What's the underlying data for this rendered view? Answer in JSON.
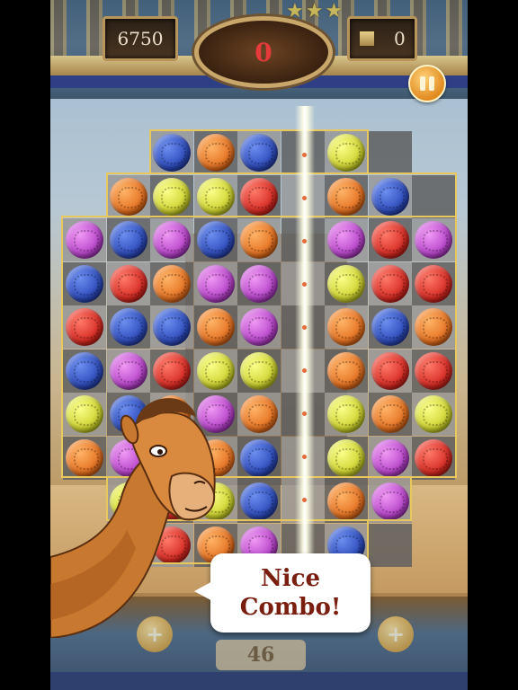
{
  "hud": {
    "score": "6750",
    "moves": "0",
    "blocks_count": "0",
    "stars": [
      "★",
      "★",
      "★"
    ],
    "pause_icon": "pause-icon"
  },
  "speech_bubble": {
    "line1": "Nice",
    "line2": "Combo!"
  },
  "bottom": {
    "number": "46",
    "boost_symbol": "+"
  },
  "board": {
    "rows": [
      [
        null,
        null,
        "light",
        "dark",
        "light",
        "dark",
        "light",
        "dark",
        null
      ],
      [
        null,
        "light",
        "dark",
        "light",
        "dark",
        "light",
        "dark",
        "light",
        "dark"
      ],
      [
        "light",
        "dark",
        "light",
        "dark",
        "light",
        "dark",
        "light",
        "dark",
        "light"
      ],
      [
        "dark",
        "light",
        "dark",
        "light",
        "dark",
        "light",
        "dark",
        "light",
        "dark"
      ],
      [
        "light",
        "dark",
        "light",
        "dark",
        "light",
        "dark",
        "light",
        "dark",
        "light"
      ],
      [
        "dark",
        "light",
        "dark",
        "light",
        "dark",
        "light",
        "dark",
        "light",
        "dark"
      ],
      [
        "light",
        "dark",
        "light",
        "dark",
        "light",
        "dark",
        "light",
        "dark",
        "light"
      ],
      [
        "dark",
        "light",
        "dark",
        "light",
        "dark",
        "light",
        "dark",
        "light",
        "dark"
      ],
      [
        null,
        "light",
        "dark",
        "light",
        "dark",
        "light",
        "dark",
        "light",
        null
      ],
      [
        null,
        null,
        "light",
        "dark",
        "light",
        "dark",
        "light",
        "dark",
        null
      ]
    ],
    "gems": [
      [
        null,
        null,
        "blue",
        "orange",
        "blue",
        null,
        "yellow",
        null,
        null
      ],
      [
        null,
        "orange",
        "yellow",
        "yellow",
        "red",
        null,
        "orange",
        "blue",
        null
      ],
      [
        "purple",
        "blue",
        "purple",
        "blue",
        "orange",
        null,
        "purple",
        "red",
        "purple"
      ],
      [
        "blue",
        "red",
        "orange",
        "purple",
        "purple",
        null,
        "yellow",
        "red",
        "red"
      ],
      [
        "red",
        "blue",
        "blue",
        "orange",
        "purple",
        null,
        "orange",
        "blue",
        "orange"
      ],
      [
        "blue",
        "purple",
        "red",
        "yellow",
        "yellow",
        null,
        "orange",
        "red",
        "red"
      ],
      [
        "yellow",
        "blue",
        "orange",
        "purple",
        "orange",
        null,
        "yellow",
        "orange",
        "yellow"
      ],
      [
        "orange",
        "purple",
        "orange",
        "orange",
        "blue",
        null,
        "yellow",
        "purple",
        "red"
      ],
      [
        null,
        "yellow",
        "red",
        "yellow",
        "blue",
        null,
        "orange",
        "purple",
        null
      ],
      [
        null,
        null,
        "red",
        "orange",
        "purple",
        null,
        "blue",
        null,
        null
      ]
    ],
    "colors": {
      "blue": "#2a47b7",
      "orange": "#e36d1d",
      "yellow": "#cbd02a",
      "red": "#d4261f",
      "purple": "#b33ec7"
    }
  }
}
